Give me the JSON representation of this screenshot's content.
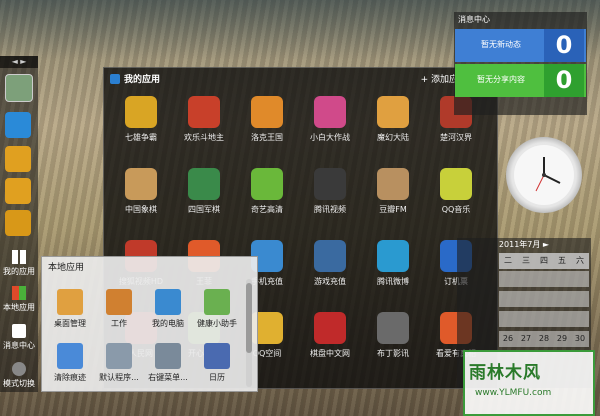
{
  "dock": {
    "top_label": "◄ ►",
    "buttons": [
      {
        "label": "我的应用"
      },
      {
        "label": "本地应用"
      },
      {
        "label": "消息中心"
      },
      {
        "label": "模式切换"
      }
    ]
  },
  "my_apps": {
    "title": "我的应用",
    "add_label": "+ 添加应用",
    "close_label": "✕",
    "apps": [
      {
        "label": "七雄争霸",
        "color": "#d9a524"
      },
      {
        "label": "欢乐斗地主",
        "color": "#c8402a"
      },
      {
        "label": "洛克王国",
        "color": "#e08a2a"
      },
      {
        "label": "小白大作战",
        "color": "#d04a8a"
      },
      {
        "label": "魔幻大陆",
        "color": "#e0a040"
      },
      {
        "label": "楚河汉界",
        "color": "#b03a2a"
      },
      {
        "label": "中国象棋",
        "color": "#c89a5a"
      },
      {
        "label": "四国军棋",
        "color": "#3a8a4a"
      },
      {
        "label": "奇艺高清",
        "color": "#6ab83a"
      },
      {
        "label": "腾讯视频",
        "color": "#3a3a3a"
      },
      {
        "label": "豆瓣FM",
        "color": "#b89060"
      },
      {
        "label": "QQ音乐",
        "color": "#c8d03a"
      },
      {
        "label": "搜狐视频HD",
        "color": "#c03a2a"
      },
      {
        "label": "王菲",
        "color": "#e05a2a"
      },
      {
        "label": "手机充值",
        "color": "#3a8ad0"
      },
      {
        "label": "游戏充值",
        "color": "#3a6aa0"
      },
      {
        "label": "腾讯微博",
        "color": "#2a9ad0"
      },
      {
        "label": "订机票",
        "color": "#2a6ac8"
      },
      {
        "label": "人民网",
        "color": "#b02a2a"
      },
      {
        "label": "开心农场",
        "color": "#6aa03a"
      },
      {
        "label": "QQ空间",
        "color": "#e0b030"
      },
      {
        "label": "棋盘中文网",
        "color": "#c02a2a"
      },
      {
        "label": "布丁影讯",
        "color": "#6a6a6a"
      },
      {
        "label": "看爱有真相",
        "color": "#e05a2a"
      }
    ]
  },
  "local_apps": {
    "title": "本地应用",
    "apps": [
      {
        "label": "桌面管理",
        "color": "#e0a040"
      },
      {
        "label": "工作",
        "color": "#d08030"
      },
      {
        "label": "我的电脑",
        "color": "#3a8ad0"
      },
      {
        "label": "健康小助手",
        "color": "#6ab050"
      },
      {
        "label": "清除痕迹",
        "color": "#4a8ad8"
      },
      {
        "label": "默认程序...",
        "color": "#8a9aaa"
      },
      {
        "label": "右键菜单...",
        "color": "#7a8a9a"
      },
      {
        "label": "日历",
        "color": "#4a6ab0"
      }
    ]
  },
  "message_center": {
    "title": "消息中心",
    "rows": [
      {
        "text": "暂无新动态",
        "count": "0",
        "bg": "#3f7fd4",
        "numbg": "#2a62b8"
      },
      {
        "text": "暂无分享内容",
        "count": "0",
        "bg": "#4fbf3f",
        "numbg": "#2fa02f"
      }
    ]
  },
  "calendar": {
    "header": "2011年7月",
    "next": "►",
    "weekdays": [
      "二",
      "三",
      "四",
      "五",
      "六"
    ],
    "days": [
      "",
      "",
      "",
      "",
      "",
      "",
      "",
      "",
      "",
      "",
      "",
      "",
      "",
      "",
      "",
      "26",
      "27",
      "28",
      "29",
      "30"
    ]
  },
  "watermark": {
    "title": "雨林木风",
    "url": "www.YLMFU.com"
  }
}
